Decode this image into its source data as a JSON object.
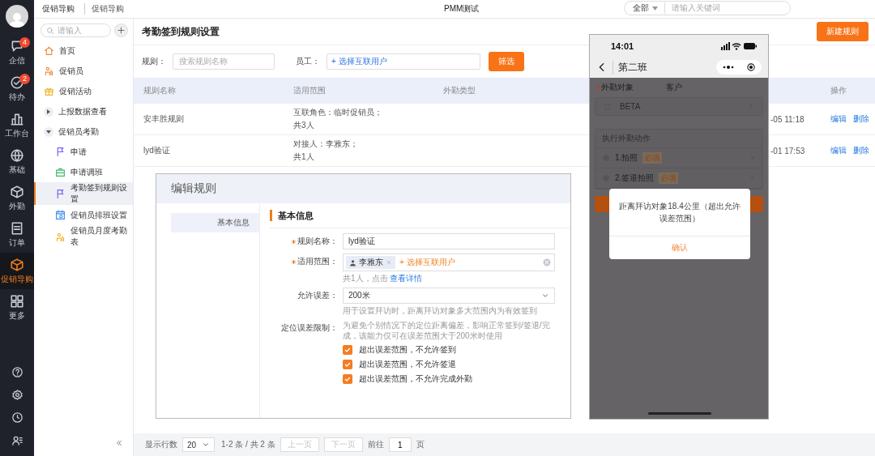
{
  "rail": {
    "items": [
      {
        "label": "企信",
        "badge": "4",
        "selected": false
      },
      {
        "label": "待办",
        "badge": "2",
        "selected": false
      },
      {
        "label": "工作台",
        "selected": false
      },
      {
        "label": "基础",
        "selected": false
      },
      {
        "label": "外勤",
        "selected": false
      },
      {
        "label": "订单",
        "selected": false
      },
      {
        "label": "促销导购",
        "selected": true
      },
      {
        "label": "更多",
        "selected": false
      }
    ]
  },
  "header": {
    "breadcrumb": [
      "促销导购",
      "促销导购"
    ],
    "title": "PMM测试",
    "search": {
      "scope": "全部",
      "placeholder": "请输入关键词"
    }
  },
  "sidebar": {
    "search_placeholder": "请输入",
    "items": [
      {
        "label": "首页",
        "selected": false
      },
      {
        "label": "促销员",
        "selected": false
      },
      {
        "label": "促销活动",
        "selected": false
      },
      {
        "label": "上报数据查看",
        "expanded": false,
        "selected": false
      },
      {
        "label": "促销员考勤",
        "expanded": true,
        "selected": false,
        "children": [
          {
            "label": "申请",
            "selected": false
          },
          {
            "label": "申请调班",
            "selected": false
          },
          {
            "label": "考勤签到规则设置",
            "selected": true
          },
          {
            "label": "促销员排班设置",
            "selected": false
          },
          {
            "label": "促销员月度考勤表",
            "selected": false
          }
        ]
      }
    ]
  },
  "main": {
    "title": "考勤签到规则设置",
    "new_button": "新建规则",
    "filters": {
      "rule_label": "规则：",
      "rule_placeholder": "搜索规则名称",
      "employee_label": "员工：",
      "employee_picker": "+ 选择互联用户",
      "button": "筛选"
    },
    "table": {
      "columns": [
        "规则名称",
        "适用范围",
        "外勤类型",
        "操作"
      ],
      "rows": [
        {
          "name": "安丰胜规则",
          "scope": [
            "互联角色：临时促销员；",
            "共3人"
          ],
          "column_5": "-05 11:18",
          "actions": [
            "编辑",
            "删除"
          ]
        },
        {
          "name": "lyd验证",
          "scope": [
            "对接人：李雅东；",
            "共1人"
          ],
          "column_5": "-01 17:53",
          "actions": [
            "编辑",
            "删除"
          ]
        }
      ]
    },
    "pagination": {
      "rows_label": "显示行数",
      "page_size": "20",
      "range": "1-2 条 / 共 2 条",
      "prev": {
        "label": "上一页",
        "disabled": true
      },
      "next": {
        "label": "下一页",
        "disabled": true
      },
      "goto_label": "前往",
      "page": "1",
      "page_suffix": "页"
    }
  },
  "edit_dialog": {
    "title": "编辑规则",
    "nav": [
      {
        "label": "基本信息",
        "selected": true
      }
    ],
    "section": "基本信息",
    "fields": [
      {
        "kind": "text",
        "label": "规则名称：",
        "required": true,
        "value": "lyd验证"
      },
      {
        "kind": "users",
        "label": "适用范围：",
        "required": true,
        "tags": [
          "李雅东"
        ],
        "add": "+ 选择互联用户",
        "hint": "共1人，点击",
        "link": "查看详情"
      },
      {
        "kind": "select",
        "label": "允许误差：",
        "required": false,
        "value": "200米",
        "hint": "用于设置拜访时，距离拜访对象多大范围内为有效签到"
      },
      {
        "kind": "checks",
        "label": "定位误差限制：",
        "required": false,
        "hint": "为避免个别情况下的定位距离偏差，影响正常签到/签退/完成，该能力仅可在误差范围大于200米时使用",
        "options": [
          {
            "label": "超出误差范围，不允许签到",
            "checked": true
          },
          {
            "label": "超出误差范围，不允许签退",
            "checked": true
          },
          {
            "label": "超出误差范围，不允许完成外勤",
            "checked": true
          }
        ]
      }
    ]
  },
  "phone": {
    "time": "14:01",
    "title": "第二班",
    "target": {
      "label": "外勤对象",
      "required": true,
      "value": "客户"
    },
    "entry": "BETA",
    "actions_title": "执行外勤动作",
    "actions": [
      {
        "label": "1.拍照",
        "tag": "必填"
      },
      {
        "label": "2.签退拍照",
        "tag": "必填"
      }
    ],
    "alert": {
      "message": "距离拜访对象18.4公里（超出允许误差范围）",
      "confirm": "确认"
    }
  }
}
